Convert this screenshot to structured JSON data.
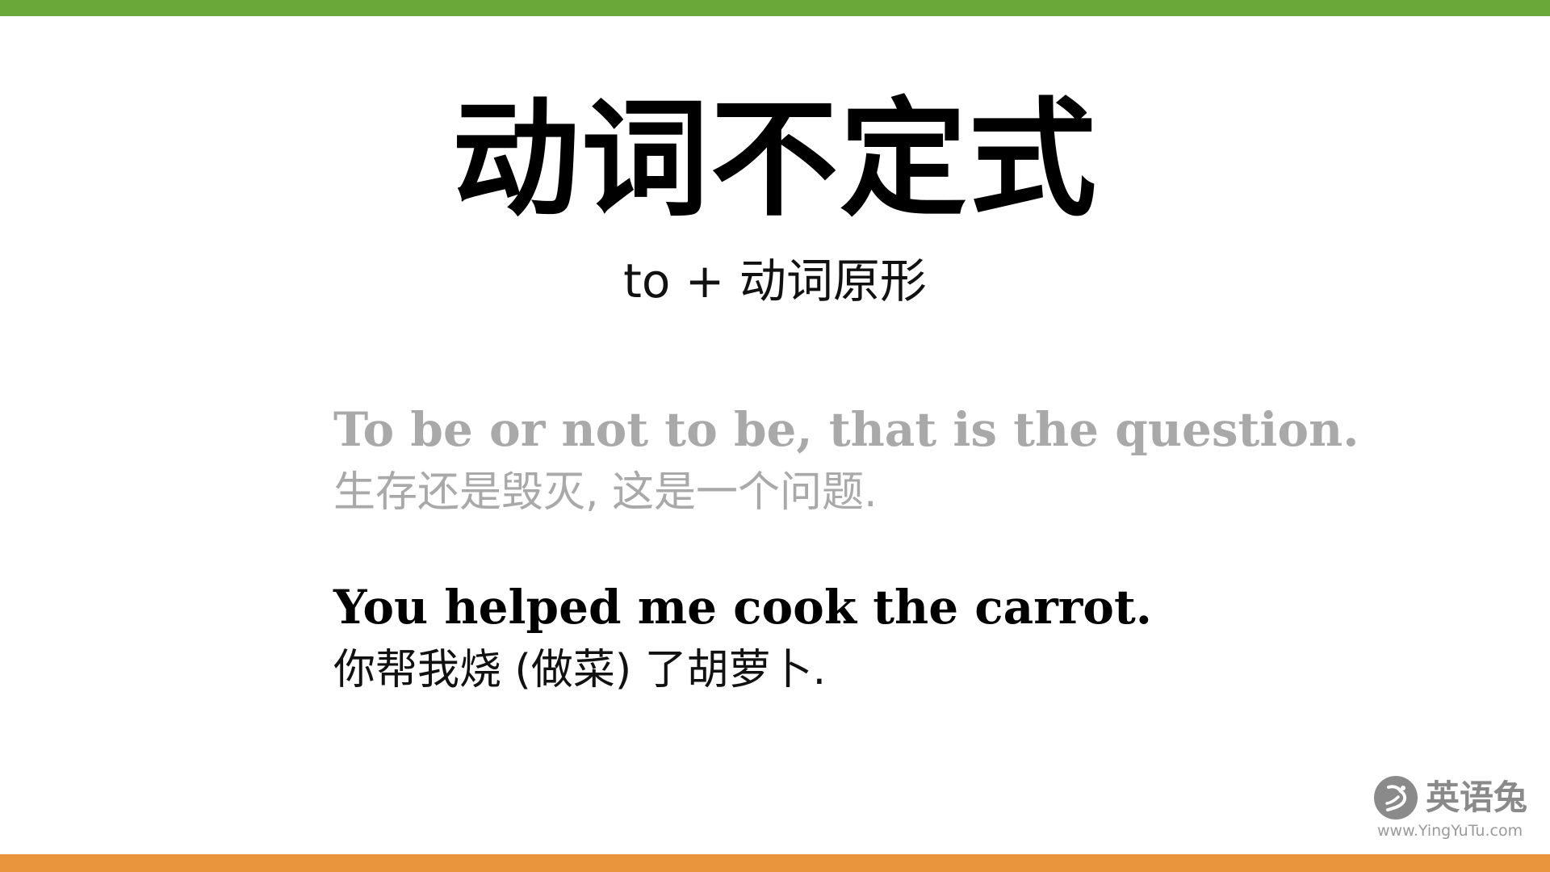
{
  "slide": {
    "title": "动词不定式",
    "subtitle": "to + 动词原形",
    "examples": [
      {
        "english": "To be or not to be, that is the question.",
        "chinese": "生存还是毁灭, 这是一个问题."
      },
      {
        "english": "You helped me cook the carrot.",
        "chinese": "你帮我烧 (做菜) 了胡萝卜."
      }
    ]
  },
  "logo": {
    "name": "英语兔",
    "url": "www.YingYuTu.com",
    "icon": "rabbit-icon"
  },
  "colors": {
    "top_bar": "#6aa83a",
    "bottom_bar": "#e8953e",
    "faded_text": "#a9a9a9",
    "logo_gray": "#8a8a8a"
  }
}
